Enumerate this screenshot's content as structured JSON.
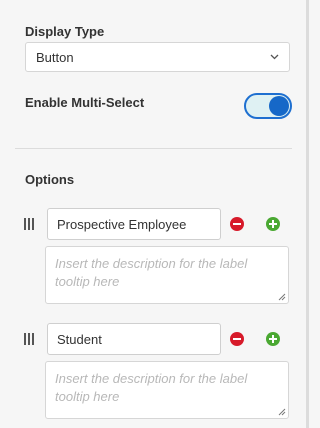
{
  "display_type": {
    "label": "Display Type",
    "value": "Button",
    "icon": "chevron-down-icon"
  },
  "multi_select": {
    "label": "Enable Multi-Select",
    "enabled": true,
    "accent": "#1668c8"
  },
  "options": {
    "heading": "Options",
    "items": [
      {
        "label": "Prospective Employee",
        "description_placeholder": "Insert the description for the label tooltip here"
      },
      {
        "label": "Student",
        "description_placeholder": "Insert the description for the label tooltip here"
      }
    ],
    "remove_color": "#d71a2a",
    "add_color": "#4aa832"
  }
}
